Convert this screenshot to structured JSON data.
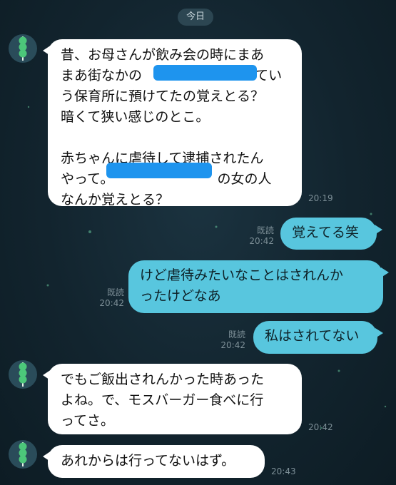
{
  "date_label": "今日",
  "messages": [
    {
      "lines": [
        "昔、お母さんが飲み会の時にまあ",
        "まあ街なかの",
        "う保育所に預けてたの覚えとる？",
        "暗くて狭い感じのとこ。",
        "",
        "赤ちゃんに虐待して逮捕されたん",
        "やって。",
        "なんか覚えとる？"
      ],
      "line2_tail": "ってい",
      "line7_tail": "の女の人",
      "time": "20:19"
    },
    {
      "text": "覚えてる笑",
      "read": "既読",
      "time": "20:42"
    },
    {
      "lines": [
        "けど虐待みたいなことはされんか",
        "ったけどなあ"
      ],
      "read": "既読",
      "time": "20:42"
    },
    {
      "text": "私はされてない",
      "read": "既読",
      "time": "20:42"
    },
    {
      "lines": [
        "でもご飯出されんかった時あった",
        "よね。で、モスバーガー食べに行",
        "ってさ。"
      ],
      "time": "20:42"
    },
    {
      "text": "あれからは行ってないはず。",
      "time": "20:43"
    }
  ],
  "colors": {
    "incoming": "#ffffff",
    "outgoing": "#58c6de",
    "background": "#12242e",
    "redaction": "#1e94ee"
  },
  "icons": {
    "avatar": "green-dango-icon"
  }
}
